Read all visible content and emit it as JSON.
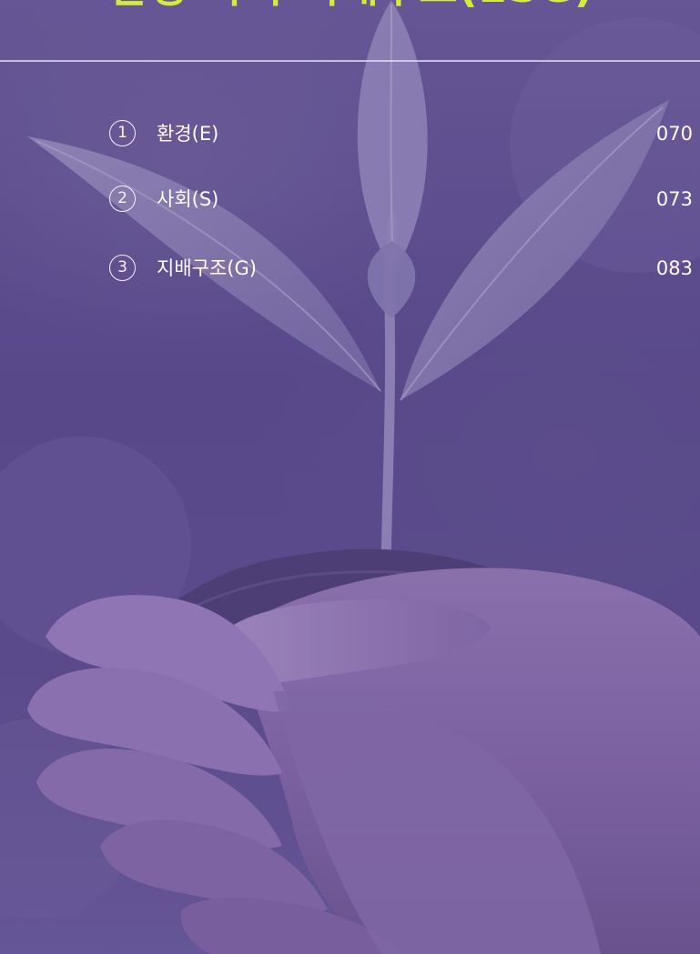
{
  "header": {
    "title": "환경·사회·지배구조(ESG)"
  },
  "toc": {
    "items": [
      {
        "number": "1",
        "label": "환경(E)",
        "page": "070"
      },
      {
        "number": "2",
        "label": "사회(S)",
        "page": "073"
      },
      {
        "number": "3",
        "label": "지배구조(G)",
        "page": "083"
      }
    ]
  },
  "colors": {
    "title": "#d6ec3c",
    "overlay": "#5b4a8c",
    "text": "#ffffff"
  },
  "icons": {
    "background_image": "seedling-in-hands-photo"
  }
}
